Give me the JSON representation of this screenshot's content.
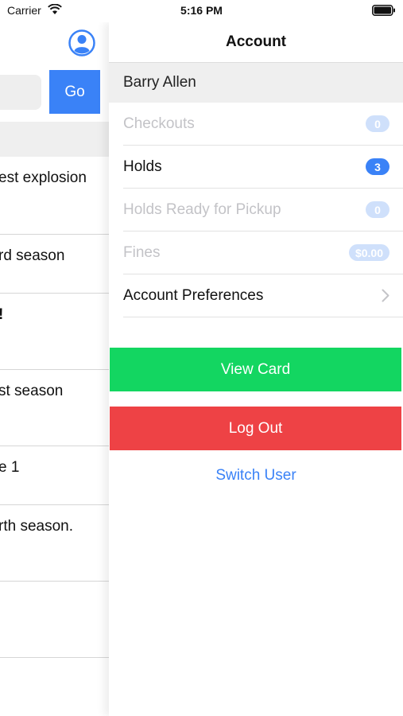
{
  "status_bar": {
    "carrier": "Carrier",
    "time": "5:16 PM"
  },
  "background_screen": {
    "go_label": "Go",
    "feed_items": [
      {
        "text": "est explosion",
        "bold": false
      },
      {
        "text": "rd season",
        "bold": false
      },
      {
        "text": "!",
        "bold": true
      },
      {
        "text": "st season",
        "bold": false
      },
      {
        "text": "e 1",
        "bold": false
      },
      {
        "text": "rth season.",
        "bold": false
      },
      {
        "text": "",
        "bold": false
      }
    ]
  },
  "account": {
    "title": "Account",
    "user_name": "Barry Allen",
    "menu": [
      {
        "label": "Checkouts",
        "badge": "0",
        "enabled": false
      },
      {
        "label": "Holds",
        "badge": "3",
        "enabled": true
      },
      {
        "label": "Holds Ready for Pickup",
        "badge": "0",
        "enabled": false
      },
      {
        "label": "Fines",
        "badge": "$0.00",
        "enabled": false
      },
      {
        "label": "Account Preferences",
        "chevron": true,
        "enabled": true
      }
    ],
    "view_card_label": "View Card",
    "log_out_label": "Log Out",
    "switch_user_label": "Switch User"
  },
  "colors": {
    "accent_blue": "#3a82f7",
    "view_card_green": "#13d661",
    "log_out_red": "#ee4245",
    "badge_inactive": "#cfe0fb",
    "disabled_text": "#c3c3c7"
  },
  "icons": {
    "wifi": "wifi-icon",
    "battery": "battery-icon",
    "profile": "profile-icon",
    "chevron": "chevron-right-icon"
  }
}
